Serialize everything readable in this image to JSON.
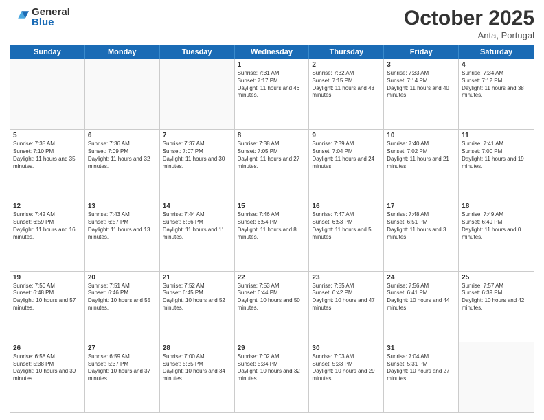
{
  "logo": {
    "general": "General",
    "blue": "Blue"
  },
  "title": {
    "month": "October 2025",
    "location": "Anta, Portugal"
  },
  "header_days": [
    "Sunday",
    "Monday",
    "Tuesday",
    "Wednesday",
    "Thursday",
    "Friday",
    "Saturday"
  ],
  "rows": [
    [
      {
        "day": "",
        "text": ""
      },
      {
        "day": "",
        "text": ""
      },
      {
        "day": "",
        "text": ""
      },
      {
        "day": "1",
        "text": "Sunrise: 7:31 AM\nSunset: 7:17 PM\nDaylight: 11 hours and 46 minutes."
      },
      {
        "day": "2",
        "text": "Sunrise: 7:32 AM\nSunset: 7:15 PM\nDaylight: 11 hours and 43 minutes."
      },
      {
        "day": "3",
        "text": "Sunrise: 7:33 AM\nSunset: 7:14 PM\nDaylight: 11 hours and 40 minutes."
      },
      {
        "day": "4",
        "text": "Sunrise: 7:34 AM\nSunset: 7:12 PM\nDaylight: 11 hours and 38 minutes."
      }
    ],
    [
      {
        "day": "5",
        "text": "Sunrise: 7:35 AM\nSunset: 7:10 PM\nDaylight: 11 hours and 35 minutes."
      },
      {
        "day": "6",
        "text": "Sunrise: 7:36 AM\nSunset: 7:09 PM\nDaylight: 11 hours and 32 minutes."
      },
      {
        "day": "7",
        "text": "Sunrise: 7:37 AM\nSunset: 7:07 PM\nDaylight: 11 hours and 30 minutes."
      },
      {
        "day": "8",
        "text": "Sunrise: 7:38 AM\nSunset: 7:05 PM\nDaylight: 11 hours and 27 minutes."
      },
      {
        "day": "9",
        "text": "Sunrise: 7:39 AM\nSunset: 7:04 PM\nDaylight: 11 hours and 24 minutes."
      },
      {
        "day": "10",
        "text": "Sunrise: 7:40 AM\nSunset: 7:02 PM\nDaylight: 11 hours and 21 minutes."
      },
      {
        "day": "11",
        "text": "Sunrise: 7:41 AM\nSunset: 7:00 PM\nDaylight: 11 hours and 19 minutes."
      }
    ],
    [
      {
        "day": "12",
        "text": "Sunrise: 7:42 AM\nSunset: 6:59 PM\nDaylight: 11 hours and 16 minutes."
      },
      {
        "day": "13",
        "text": "Sunrise: 7:43 AM\nSunset: 6:57 PM\nDaylight: 11 hours and 13 minutes."
      },
      {
        "day": "14",
        "text": "Sunrise: 7:44 AM\nSunset: 6:56 PM\nDaylight: 11 hours and 11 minutes."
      },
      {
        "day": "15",
        "text": "Sunrise: 7:46 AM\nSunset: 6:54 PM\nDaylight: 11 hours and 8 minutes."
      },
      {
        "day": "16",
        "text": "Sunrise: 7:47 AM\nSunset: 6:53 PM\nDaylight: 11 hours and 5 minutes."
      },
      {
        "day": "17",
        "text": "Sunrise: 7:48 AM\nSunset: 6:51 PM\nDaylight: 11 hours and 3 minutes."
      },
      {
        "day": "18",
        "text": "Sunrise: 7:49 AM\nSunset: 6:49 PM\nDaylight: 11 hours and 0 minutes."
      }
    ],
    [
      {
        "day": "19",
        "text": "Sunrise: 7:50 AM\nSunset: 6:48 PM\nDaylight: 10 hours and 57 minutes."
      },
      {
        "day": "20",
        "text": "Sunrise: 7:51 AM\nSunset: 6:46 PM\nDaylight: 10 hours and 55 minutes."
      },
      {
        "day": "21",
        "text": "Sunrise: 7:52 AM\nSunset: 6:45 PM\nDaylight: 10 hours and 52 minutes."
      },
      {
        "day": "22",
        "text": "Sunrise: 7:53 AM\nSunset: 6:44 PM\nDaylight: 10 hours and 50 minutes."
      },
      {
        "day": "23",
        "text": "Sunrise: 7:55 AM\nSunset: 6:42 PM\nDaylight: 10 hours and 47 minutes."
      },
      {
        "day": "24",
        "text": "Sunrise: 7:56 AM\nSunset: 6:41 PM\nDaylight: 10 hours and 44 minutes."
      },
      {
        "day": "25",
        "text": "Sunrise: 7:57 AM\nSunset: 6:39 PM\nDaylight: 10 hours and 42 minutes."
      }
    ],
    [
      {
        "day": "26",
        "text": "Sunrise: 6:58 AM\nSunset: 5:38 PM\nDaylight: 10 hours and 39 minutes."
      },
      {
        "day": "27",
        "text": "Sunrise: 6:59 AM\nSunset: 5:37 PM\nDaylight: 10 hours and 37 minutes."
      },
      {
        "day": "28",
        "text": "Sunrise: 7:00 AM\nSunset: 5:35 PM\nDaylight: 10 hours and 34 minutes."
      },
      {
        "day": "29",
        "text": "Sunrise: 7:02 AM\nSunset: 5:34 PM\nDaylight: 10 hours and 32 minutes."
      },
      {
        "day": "30",
        "text": "Sunrise: 7:03 AM\nSunset: 5:33 PM\nDaylight: 10 hours and 29 minutes."
      },
      {
        "day": "31",
        "text": "Sunrise: 7:04 AM\nSunset: 5:31 PM\nDaylight: 10 hours and 27 minutes."
      },
      {
        "day": "",
        "text": ""
      }
    ]
  ]
}
